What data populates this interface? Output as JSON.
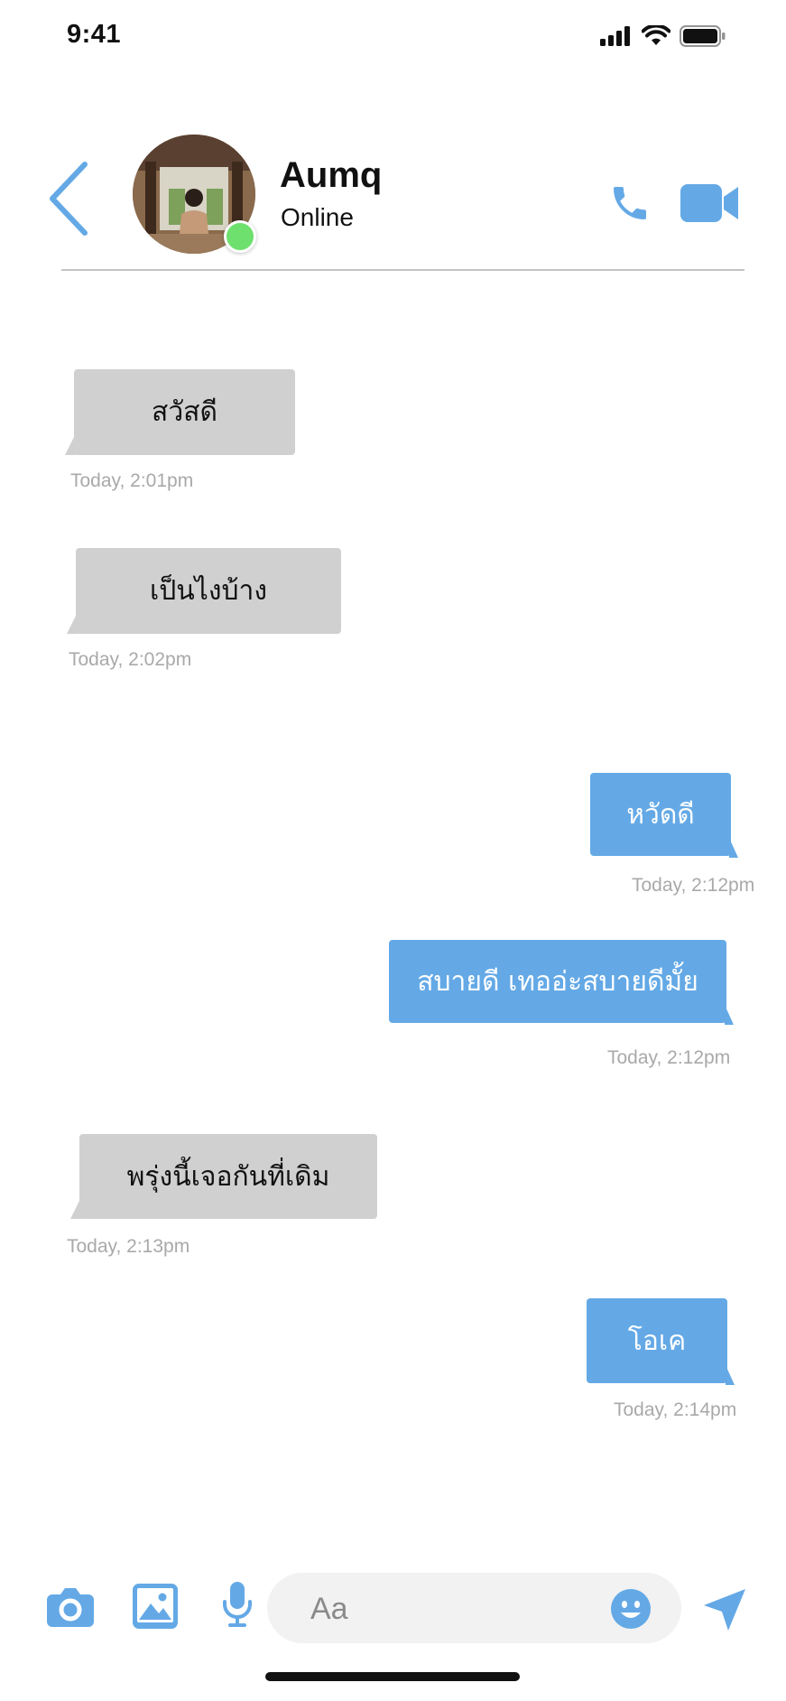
{
  "status_bar": {
    "time": "9:41"
  },
  "header": {
    "contact_name": "Aumq",
    "contact_status": "Online",
    "icons": {
      "back": "chevron-left-icon",
      "call": "phone-icon",
      "video": "video-camera-icon"
    },
    "accent_color": "#64A9E6",
    "online_color": "#6EE06E"
  },
  "messages": [
    {
      "direction": "in",
      "text": "สวัสดี",
      "time": "Today, 2:01pm"
    },
    {
      "direction": "in",
      "text": "เป็นไงบ้าง",
      "time": "Today, 2:02pm"
    },
    {
      "direction": "out",
      "text": "หวัดดี",
      "time": "Today, 2:12pm"
    },
    {
      "direction": "out",
      "text": "สบายดี เทออ่ะสบายดีมั้ย",
      "time": "Today, 2:12pm"
    },
    {
      "direction": "in",
      "text": "พรุ่งนี้เจอกันที่เดิม",
      "time": "Today, 2:13pm"
    },
    {
      "direction": "out",
      "text": "โอเค",
      "time": "Today, 2:14pm"
    }
  ],
  "composer": {
    "placeholder": "Aa",
    "icons": {
      "camera": "camera-icon",
      "gallery": "image-icon",
      "mic": "microphone-icon",
      "emoji": "emoji-icon",
      "send": "send-icon"
    }
  },
  "colors": {
    "incoming_bubble": "#D0D0D0",
    "outgoing_bubble": "#64A9E6",
    "timestamp": "#A9A9A9",
    "input_background": "#F2F2F2"
  }
}
